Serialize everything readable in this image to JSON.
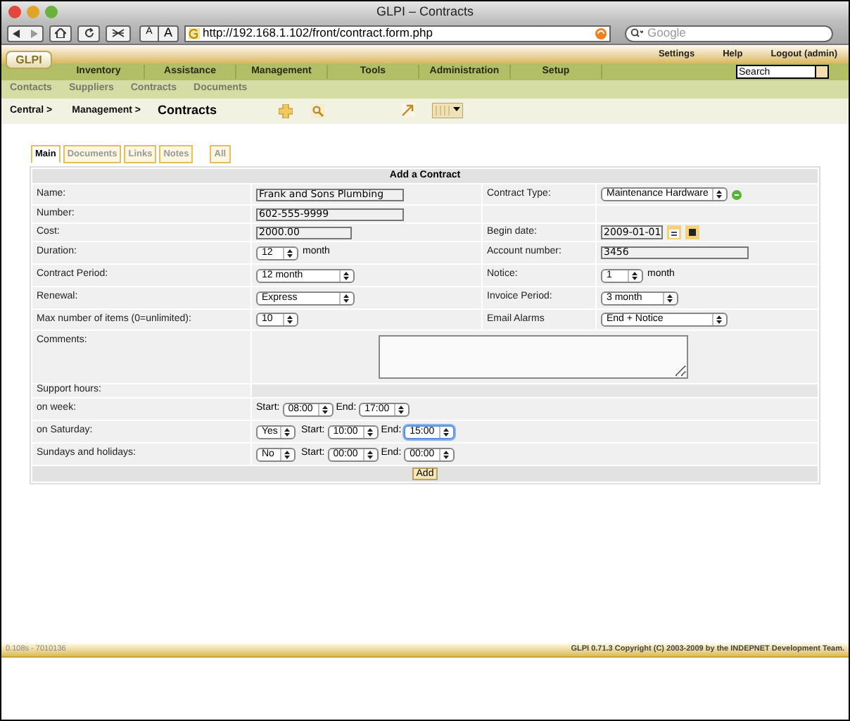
{
  "window": {
    "title": "GLPI – Contracts"
  },
  "toolbar": {
    "buttons": [
      "A",
      "A"
    ],
    "url": "http://192.168.1.102/front/contract.form.php",
    "search_placeholder": "Google"
  },
  "header": {
    "logo": "GLPI",
    "links": [
      "Settings",
      "Help",
      "**Logout** (admin)"
    ],
    "search_value": "Search",
    "menu": [
      "Inventory",
      "Assistance",
      "Management",
      "Tools",
      "Administration",
      "Setup"
    ],
    "submenu": [
      "Contacts",
      "Suppliers",
      "Contracts",
      "Documents"
    ]
  },
  "breadcrumb": {
    "items": [
      "Central >",
      "Management >"
    ],
    "title": "Contracts"
  },
  "tabs": [
    {
      "label": "Main",
      "selected": true
    },
    {
      "label": "Documents",
      "selected": false
    },
    {
      "label": "Links",
      "selected": false
    },
    {
      "label": "Notes",
      "selected": false
    },
    {
      "label": "All",
      "selected": false
    }
  ],
  "form": {
    "title": "Add a Contract",
    "rows": [
      {
        "label": "Name:",
        "control": {
          "kind": "text",
          "value": "Frank and Sons Plumbing"
        },
        "right": {
          "label": "Contract Type:",
          "control": {
            "kind": "select",
            "value": "Maintenance Hardware",
            "add_button": true
          }
        }
      },
      {
        "label": "Number:",
        "control": {
          "kind": "text",
          "value": "602-555-9999"
        }
      },
      {
        "label": "Cost:",
        "control": {
          "kind": "short",
          "value": "2000.00"
        },
        "right": {
          "label": "Begin date:",
          "control": {
            "kind": "date",
            "value": "2009-01-01"
          }
        }
      },
      {
        "label": "Duration:",
        "control": {
          "kind": "select",
          "value": "12",
          "suffix": "month"
        },
        "right": {
          "label": "Account number:",
          "control": {
            "kind": "text",
            "value": "3456"
          }
        }
      },
      {
        "label": "Contract Period:",
        "control": {
          "kind": "select",
          "value": "12 month"
        },
        "right": {
          "label": "Notice:",
          "control": {
            "kind": "select",
            "value": "1",
            "suffix": "month"
          }
        }
      },
      {
        "label": "Renewal:",
        "control": {
          "kind": "select",
          "value": "Express"
        },
        "right": {
          "label": "Invoice Period:",
          "control": {
            "kind": "select",
            "value": "3 month"
          }
        }
      },
      {
        "label": "Max number of items (0=unlimited):",
        "control": {
          "kind": "select",
          "value": "10"
        },
        "right": {
          "label": "Email Alarms",
          "control": {
            "kind": "select",
            "value": "End + Notice"
          }
        }
      },
      {
        "label": "Comments:",
        "control": {
          "kind": "textarea"
        }
      }
    ],
    "support_title": "Support hours:",
    "support_rows": [
      {
        "label": "on week:",
        "start_label": "Start:",
        "start": "08:00",
        "end_label": "End:",
        "end": "17:00",
        "start_focused": false,
        "end_focused": false
      },
      {
        "label": "on Saturday:",
        "toggle": "Yes",
        "start_label": "Start:",
        "start": "10:00",
        "end_label": "End:",
        "end": "15:00",
        "start_focused": false,
        "end_focused": true
      },
      {
        "label": "Sundays and holidays:",
        "toggle": "No",
        "start_label": "Start:",
        "start": "00:00",
        "end_label": "End:",
        "end": "00:00",
        "start_focused": false,
        "end_focused": false
      }
    ],
    "submit": "Add"
  },
  "footer": {
    "left": "0.108s - 7010136",
    "right": "GLPI 0.71.3 Copyright (C) 2003-2009 by the INDEPNET Development Team."
  }
}
